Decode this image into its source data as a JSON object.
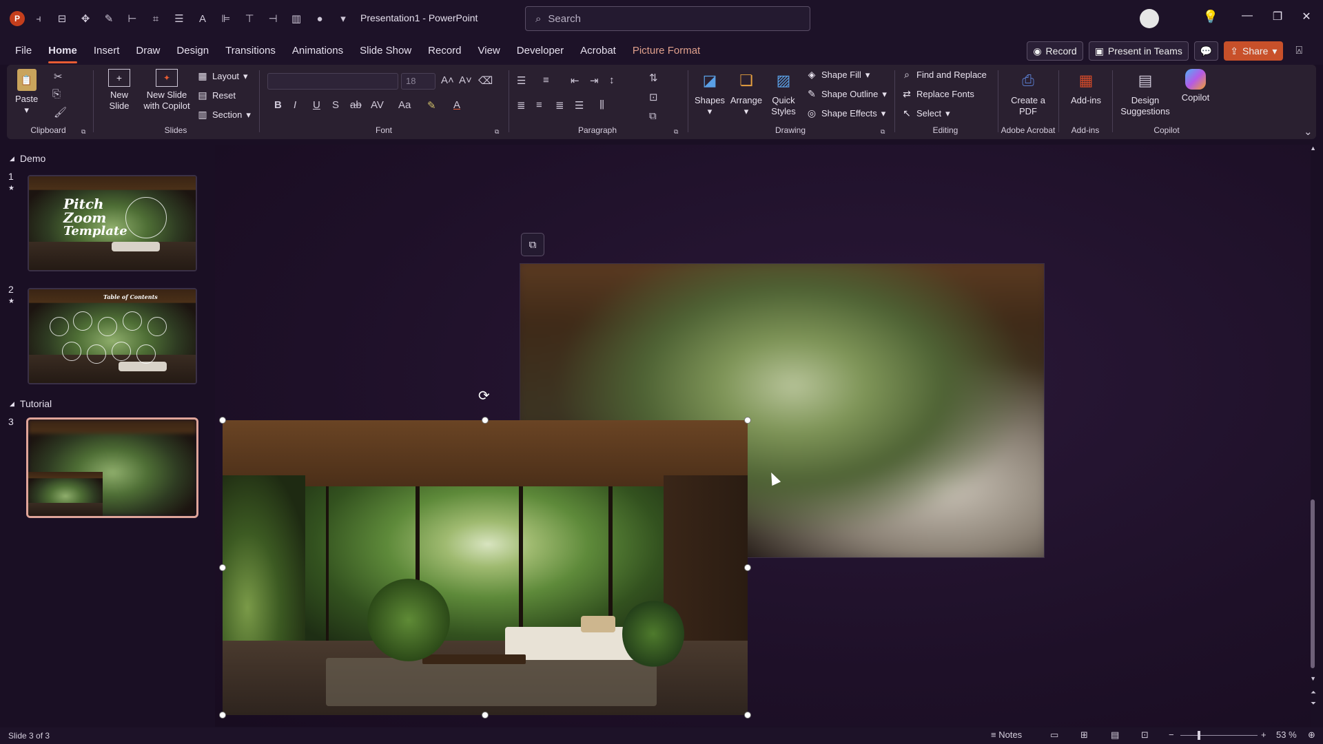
{
  "window": {
    "title": "Presentation1  -  PowerPoint",
    "app_icon_letter": "P"
  },
  "search": {
    "placeholder": "Search"
  },
  "menu": {
    "tabs": [
      "File",
      "Home",
      "Insert",
      "Draw",
      "Design",
      "Transitions",
      "Animations",
      "Slide Show",
      "Record",
      "View",
      "Developer",
      "Acrobat",
      "Picture Format"
    ],
    "active_tab": "Home",
    "record_label": "Record",
    "present_teams_label": "Present in Teams",
    "share_label": "Share"
  },
  "ribbon": {
    "clipboard": {
      "label": "Clipboard",
      "paste": "Paste"
    },
    "slides": {
      "label": "Slides",
      "new_slide": "New Slide",
      "new_slide_copilot": "New Slide with Copilot",
      "layout": "Layout",
      "reset": "Reset",
      "section": "Section"
    },
    "font": {
      "label": "Font",
      "font_size": "18",
      "font_name": ""
    },
    "paragraph": {
      "label": "Paragraph"
    },
    "drawing": {
      "label": "Drawing",
      "shapes": "Shapes",
      "arrange": "Arrange",
      "quick_styles": "Quick Styles",
      "shape_fill": "Shape Fill",
      "shape_outline": "Shape Outline",
      "shape_effects": "Shape Effects"
    },
    "editing": {
      "label": "Editing",
      "find_replace": "Find and Replace",
      "replace_fonts": "Replace Fonts",
      "select": "Select"
    },
    "adobe": {
      "label": "Adobe Acrobat",
      "create_pdf": "Create a PDF"
    },
    "addins": {
      "label": "Add-ins",
      "addins_btn": "Add-ins"
    },
    "copilot": {
      "label": "Copilot",
      "design_suggestions": "Design Suggestions",
      "copilot_btn": "Copilot"
    }
  },
  "thumbnails": {
    "section1": "Demo",
    "section2": "Tutorial",
    "slides": [
      {
        "number": "1",
        "title_lines": [
          "Pitch",
          "Zoom",
          "Template"
        ]
      },
      {
        "number": "2",
        "title": "Table of Contents"
      },
      {
        "number": "3"
      }
    ]
  },
  "status": {
    "slide_info": "Slide 3 of 3",
    "notes": "Notes",
    "zoom": "53 %"
  },
  "colors": {
    "accent": "#e85c33",
    "background": "#1a0f24",
    "ribbon": "#2a2030",
    "selected_thumb": "#e0a59a"
  }
}
